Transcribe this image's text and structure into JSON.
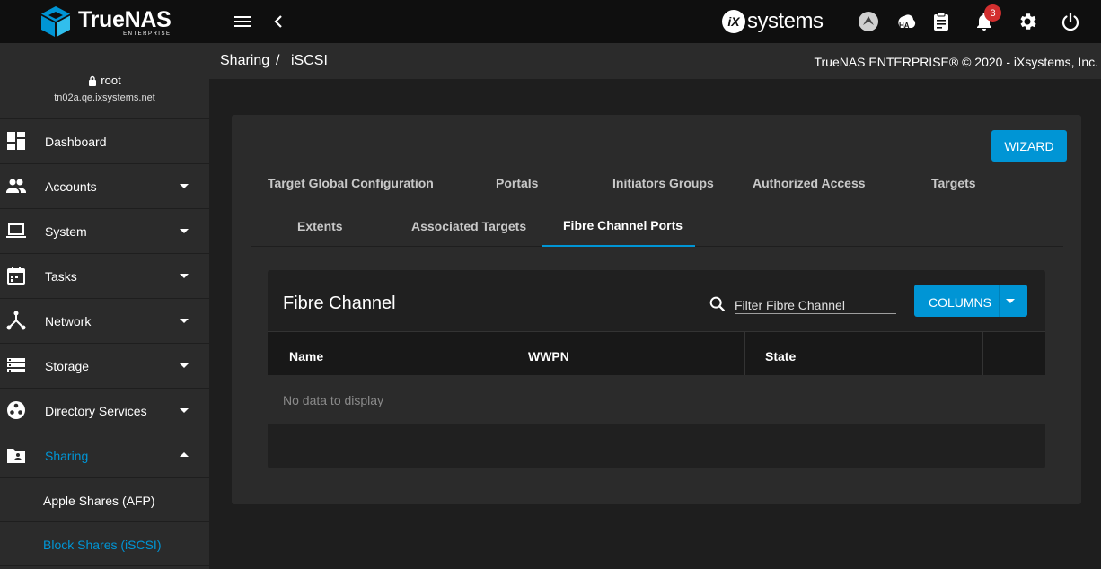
{
  "topbar": {
    "brand": "TrueNAS",
    "brand_sub": "ENTERPRISE",
    "vendor_mark": "iX",
    "vendor_name": "systems",
    "notification_count": "3",
    "icons": [
      "menu-icon",
      "back-icon",
      "truecommand-icon",
      "ha-icon",
      "tasks-clipboard-icon",
      "notifications-bell-icon",
      "settings-gear-icon",
      "power-icon"
    ]
  },
  "user": {
    "name": "root",
    "host": "tn02a.qe.ixsystems.net"
  },
  "sidebar": {
    "items": [
      {
        "label": "Dashboard",
        "icon": "dashboard-icon"
      },
      {
        "label": "Accounts",
        "icon": "accounts-icon"
      },
      {
        "label": "System",
        "icon": "system-icon"
      },
      {
        "label": "Tasks",
        "icon": "tasks-icon"
      },
      {
        "label": "Network",
        "icon": "network-icon"
      },
      {
        "label": "Storage",
        "icon": "storage-icon"
      },
      {
        "label": "Directory Services",
        "icon": "directory-icon"
      },
      {
        "label": "Sharing",
        "icon": "sharing-icon"
      }
    ],
    "sub_items": [
      {
        "label": "Apple Shares (AFP)"
      },
      {
        "label": "Block Shares (iSCSI)"
      }
    ]
  },
  "breadcrumb": {
    "parent": "Sharing",
    "separator": "/",
    "current": "iSCSI"
  },
  "copyright": "TrueNAS ENTERPRISE® © 2020 - iXsystems, Inc.",
  "main": {
    "wizard_label": "WIZARD",
    "tabs": [
      {
        "label": "Target Global Configuration"
      },
      {
        "label": "Portals"
      },
      {
        "label": "Initiators Groups"
      },
      {
        "label": "Authorized Access"
      },
      {
        "label": "Targets"
      },
      {
        "label": "Extents"
      },
      {
        "label": "Associated Targets"
      },
      {
        "label": "Fibre Channel Ports"
      }
    ],
    "active_tab": "Fibre Channel Ports"
  },
  "table": {
    "title": "Fibre Channel",
    "filter_placeholder": "Filter Fibre Channel",
    "columns_label": "COLUMNS",
    "headers": [
      "Name",
      "WWPN",
      "State"
    ],
    "empty_text": "No data to display"
  },
  "colors": {
    "accent": "#0095d5",
    "topbar": "#0f0f0f",
    "sidebar": "#2b2b2b",
    "background": "#1e1e1e",
    "badge": "#d32f2f"
  }
}
